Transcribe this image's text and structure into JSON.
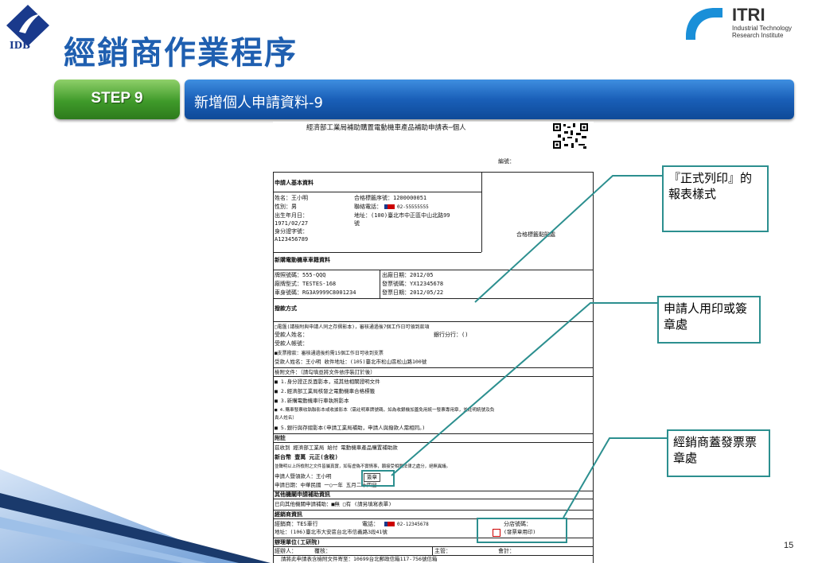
{
  "header": {
    "logo_text": "IDB",
    "title": "經銷商作業程序",
    "partner_logo": {
      "name": "ITRI",
      "line1": "Industrial Technology",
      "line2": "Research Institute"
    }
  },
  "step": {
    "label": "STEP 9",
    "title": "新增個人申請資料-9"
  },
  "page_number": "15",
  "callouts": {
    "formal_print": "『正式列印』的報表樣式",
    "applicant_stamp": "申請人用印或簽章處",
    "dealer_stamp": "經銷商蓋發票票章處"
  },
  "form": {
    "heading": "經濟部工業局補助購置電動機車產品補助申請表─個人",
    "serial_label": "編號：",
    "sec_applicant": "申請人基本資料",
    "name": "姓名：王小明",
    "cert_no": "合格標籤序號：1200000051",
    "gender": "性別：男",
    "phone": "聯絡電話：",
    "phone_value": "02-55555555",
    "birth_label": "出生年月日：",
    "birth_value": "1971/02/27",
    "address": "地址：(100)臺北市中正區中山北路99",
    "address_cont": "號",
    "id_label": "身分證字號：",
    "id_value": "A123456789",
    "label_area": "合格標籤黏貼處",
    "sec_vehicle": "新購電動機車車籍資料",
    "plate": "牌照號碼：555-QQQ",
    "factory_date": "出廠日期：2012/05",
    "model": "廠牌型式：TESTES-168",
    "invoice_no": "發票號碼：YX12345678",
    "body_no": "車身號碼：RG3A9999C8001234",
    "invoice_date": "發票日期：2012/05/22",
    "sec_payment": "撥款方式",
    "pay1": "□電匯(請檢附與申請人同之存摺影本)，審核通過後7個工作日可領到款項",
    "pay2": "受款人姓名：",
    "pay2b": "銀行分行：()",
    "pay3": "受款人帳號：",
    "pay4": "■支票撥款：審核通過後約需15個工作日可收到支票",
    "pay5": "受款人姓名：王小明  收件地址：(105)臺北市松山區松山路100號",
    "sec_docs": "檢附文件：（請勾填並將文件依序裝訂於後）",
    "doc1": "■ 1.身分證正反面影本，或其他相關證明文件",
    "doc2": "■ 2.經濟部工業局核發之電動機車合格標籤",
    "doc3": "■ 3.新購電動機車行車執照影本",
    "doc4": "■ 4.購車發票收執聯影本或收據影本（需註明車牌號碼，如為收銀機加蓋免用統一發票專用章，並註明統號及負",
    "doc4b": "責人姓名）",
    "doc5": "■ 5.銀行與存摺影本(申請工業局補助，申請人與撥款人需相同。)",
    "sec_attach": "附註",
    "receipt": "茲收到  經濟部工業局  給付   電動機車產品購置補助款",
    "amount": "新台幣 壹萬 元正(含稅)",
    "declare": "並聲明以上所檢附之文件皆屬真實，如有虛偽不實情事，願接受相關法律之處分，絕無異議。",
    "signer": "申請人暨領款人：王小明",
    "stamp_box": "簽章",
    "apply_date": "申請日期：中華民國 一○一年 五月二十四日",
    "sec_other": "其他機關申請補助資訊",
    "other": "已向其他機關申請補助：■無 □有 (請另填寫表單)",
    "sec_dealer": "經銷商資訊",
    "dealer": "經銷商：TES車行",
    "dealer_phone": "電話：",
    "dealer_phone_value": "02-12345678",
    "dealer_addr": "地址：(106)臺北市大安區台北市信義路3段41號",
    "branch_label": "分店號碼：",
    "dealer_stamp_text": "(發票章用印)",
    "sec_office": "辦理單位(工研院)",
    "handler": "經辦人：",
    "review": "覆核：",
    "supervisor": "主管：",
    "accountant": "會計：",
    "mail_note": "請將此申請表含檢附文件寄至：10699台北郵政信箱117-756號信箱"
  },
  "colors": {
    "title": "#1f5fb0",
    "step_green": "#3f9a2a",
    "step_blue": "#1a5fb8",
    "callout_border": "#2c8f8f"
  }
}
